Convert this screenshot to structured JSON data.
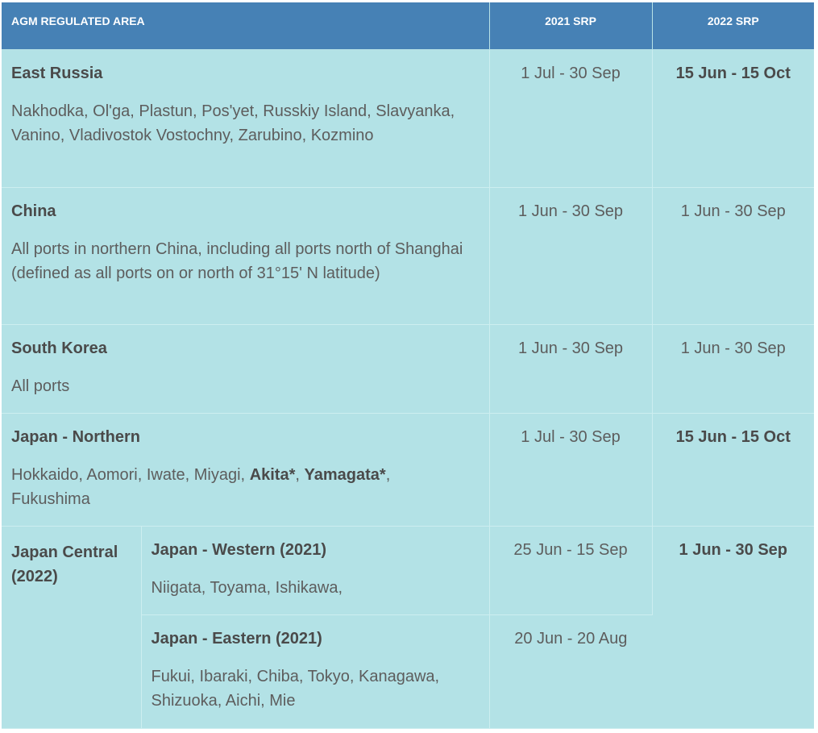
{
  "header": {
    "col_area": "AGM REGULATED AREA",
    "col_2021": "2021 SRP",
    "col_2022": "2022 SRP"
  },
  "rows": [
    {
      "region": "East Russia",
      "ports": "Nakhodka, Ol'ga, Plastun, Pos'yet, Russkiy Island, Slavyanka, Vanino, Vladivostok Vostochny, Zarubino, Kozmino",
      "srp_2021": "1 Jul - 30 Sep",
      "srp_2022": "15 Jun - 15 Oct"
    },
    {
      "region": "China",
      "ports": "All ports in northern China, including all ports north of Shanghai (defined as all ports on or north of 31°15' N latitude)",
      "srp_2021": "1 Jun - 30 Sep",
      "srp_2022": "1 Jun - 30 Sep"
    },
    {
      "region": "South Korea",
      "ports": "All ports",
      "srp_2021": "1 Jun - 30 Sep",
      "srp_2022": "1 Jun - 30 Sep"
    },
    {
      "region": "Japan - Northern",
      "ports_a": "Hokkaido, Aomori, Iwate, Miyagi, ",
      "ports_b": "Akita*",
      "ports_c": ", ",
      "ports_d": "Yamagata*",
      "ports_e": ",",
      "ports_f": "Fukushima",
      "srp_2021": "1 Jul - 30 Sep",
      "srp_2022": "15 Jun - 15 Oct"
    }
  ],
  "japan_central": {
    "group_label": "Japan Central (2022)",
    "srp_2022": "1 Jun - 30 Sep",
    "western": {
      "region": "Japan - Western (2021)",
      "ports": "Niigata, Toyama, Ishikawa,",
      "srp_2021": "25 Jun - 15 Sep"
    },
    "eastern": {
      "region": "Japan - Eastern (2021)",
      "ports": "Fukui, Ibaraki, Chiba, Tokyo, Kanagawa, Shizuoka, Aichi, Mie",
      "srp_2021": "20 Jun - 20 Aug"
    }
  },
  "colors": {
    "header_bg": "#4681b5",
    "cell_bg": "#b3e2e6",
    "header_text": "#ffffff",
    "body_text": "#5d5d5d"
  }
}
